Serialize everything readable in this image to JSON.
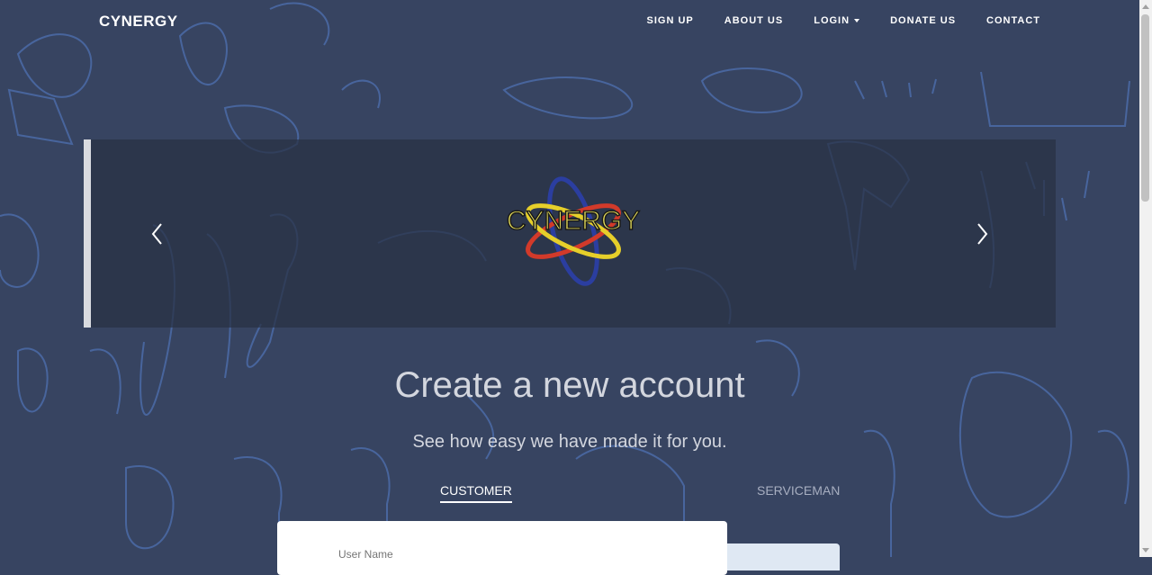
{
  "nav": {
    "brand": "CYNERGY",
    "links": [
      {
        "label": "SIGN UP"
      },
      {
        "label": "ABOUT US"
      },
      {
        "label": "LOGIN"
      },
      {
        "label": "DONATE US"
      },
      {
        "label": "CONTACT"
      }
    ]
  },
  "carousel": {
    "logo_text": "CYNERGY"
  },
  "hero": {
    "title": "Create a new account",
    "subtitle": "See how easy we have made it for you."
  },
  "tabs": [
    {
      "label": "CUSTOMER",
      "active": true
    },
    {
      "label": "SERVICEMAN",
      "active": false
    }
  ],
  "form": {
    "username_placeholder": "User Name"
  },
  "colors": {
    "background": "#374461",
    "doodle_stroke": "#4b6ba8",
    "logo_text": "#e8e05a"
  }
}
